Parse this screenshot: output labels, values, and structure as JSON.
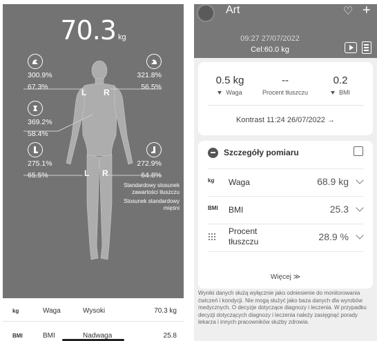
{
  "left": {
    "weight_value": "70.3",
    "weight_unit": "kg",
    "segments": {
      "left_arm": {
        "v1": "300.9%",
        "v2": "67.3%"
      },
      "right_arm": {
        "v1": "321.8%",
        "v2": "56.5%"
      },
      "trunk": {
        "v1": "369.2%",
        "v2": "58.4%"
      },
      "left_leg": {
        "v1": "275.1%",
        "v2": "65.5%"
      },
      "right_leg": {
        "v1": "272.9%",
        "v2": "64.8%"
      }
    },
    "side_labels": {
      "l": "L",
      "r": "R"
    },
    "legend": {
      "line1": "Standardowy stosunek",
      "line2": "zawartości tłuszczu",
      "line3": "Stosunek standardowy",
      "line4": "mięśni"
    },
    "bottom_rows": [
      {
        "icon": "kg",
        "label": "Waga",
        "status": "Wysoki",
        "value": "70.3 kg"
      },
      {
        "icon": "BMI",
        "label": "BMI",
        "status": "Nadwaga",
        "value": "25.8"
      }
    ]
  },
  "right": {
    "user_name": "Art",
    "datetime": "09:27 27/07/2022",
    "goal": "Cel:60.0 kg",
    "summary": {
      "weight": {
        "value": "0.5 kg",
        "label": "Waga"
      },
      "fat": {
        "value": "--",
        "label": "Procent tłuszczu"
      },
      "bmi": {
        "value": "0.2",
        "label": "BMI"
      },
      "contrast": "Kontrast 11:24 26/07/2022 →"
    },
    "details": {
      "title": "Szczegóły pomiaru",
      "rows": [
        {
          "icon": "kg",
          "label": "Waga",
          "value": "68.9 kg"
        },
        {
          "icon": "BMI",
          "label": "BMI",
          "value": "25.3"
        },
        {
          "icon": "fat-dots",
          "label": "Procent tłuszczu",
          "value": "28.9 %"
        }
      ],
      "more": "Więcej ≫"
    },
    "disclaimer": "Wyniki danych służą wyłącznie jako odniesienie do monitorowania ćwiczeń i kondycji. Nie mogą służyć jako baza danych dla wyrobów medycznych. O decyzje dotyczące diagnozy i leczenia. W przypadku decyzji dotyczących diagnozy i leczenia należy zasięgnąć porady lekarza i innych pracowników służby zdrowia."
  }
}
